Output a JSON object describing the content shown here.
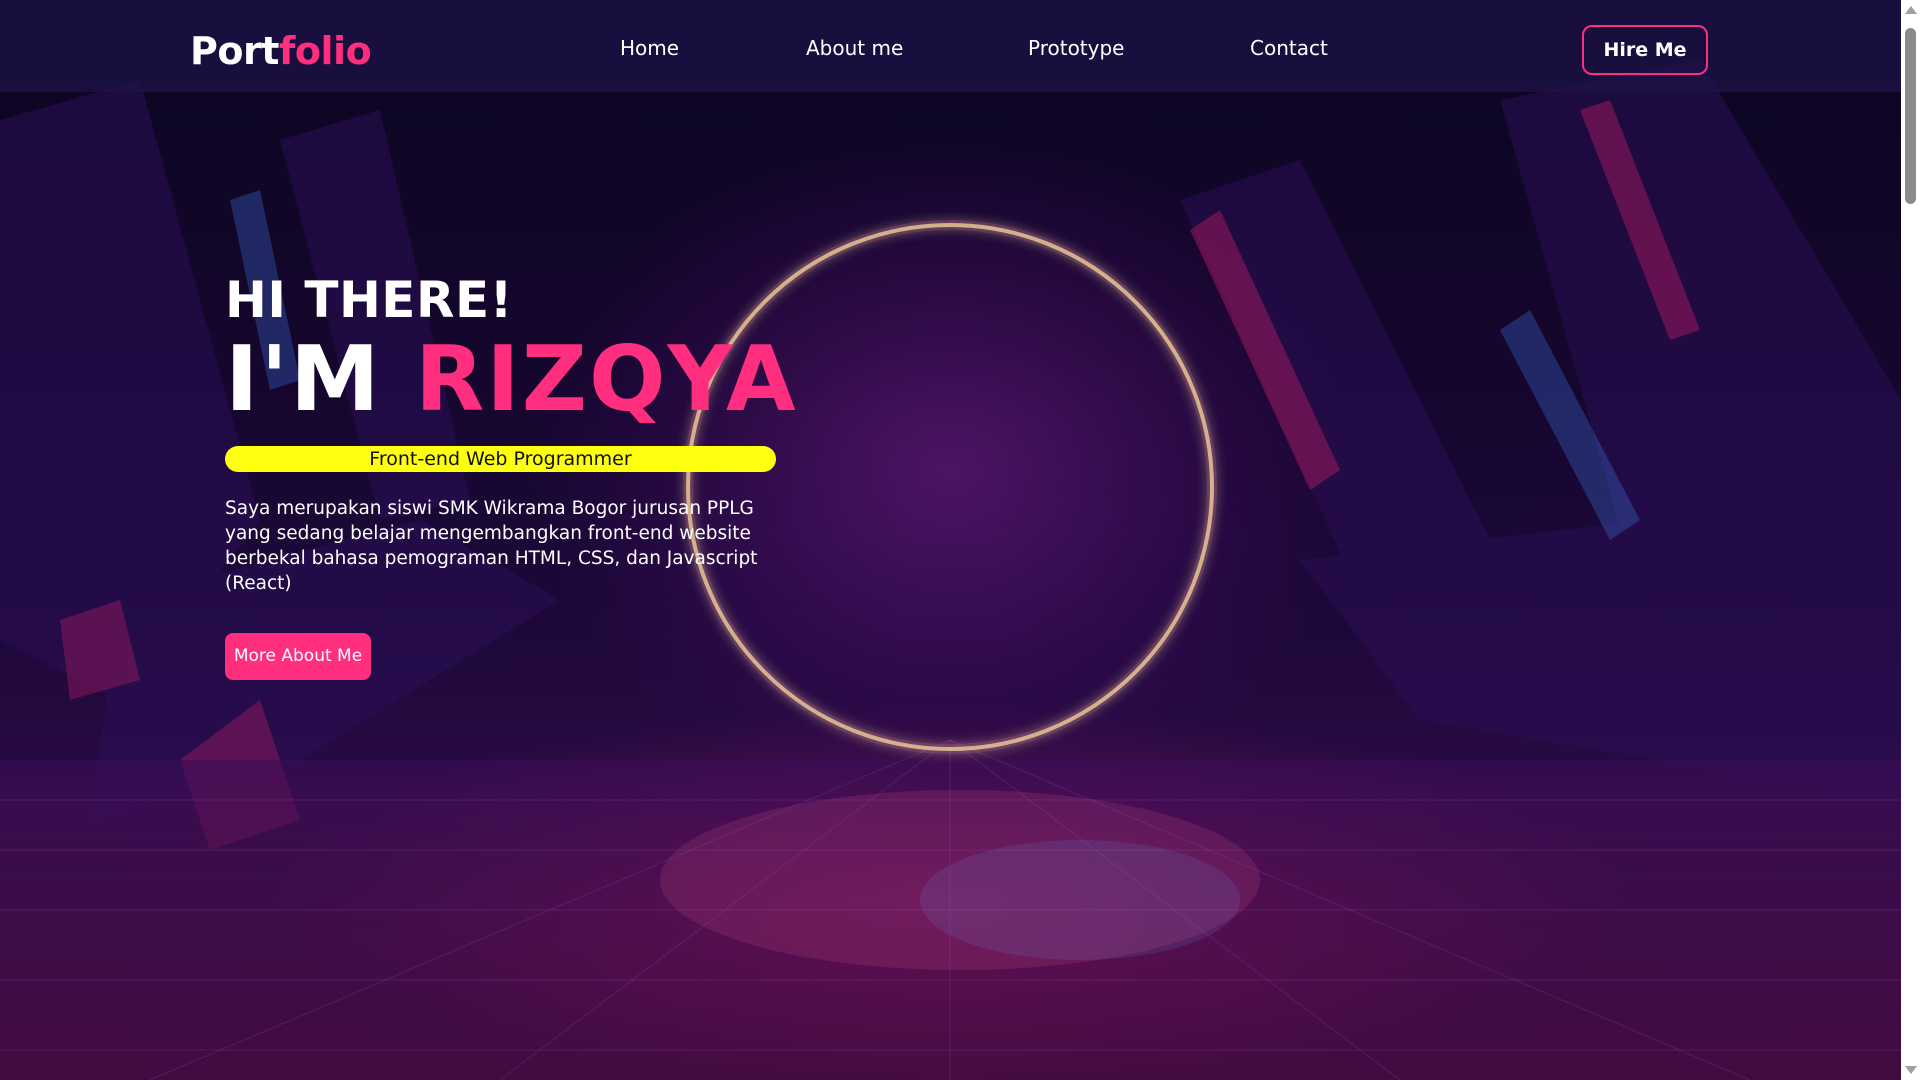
{
  "navbar": {
    "logo_part1": "Port",
    "logo_part2": "folio",
    "links": [
      {
        "label": "Home"
      },
      {
        "label": "About me"
      },
      {
        "label": "Prototype"
      },
      {
        "label": "Contact"
      }
    ],
    "hire_label": "Hire Me"
  },
  "hero": {
    "greeting": "HI THERE!",
    "name_prefix": "I'M ",
    "name_highlight": "RIZQYA",
    "role": "Front-end Web Programmer",
    "description": "Saya merupakan siswi SMK Wikrama Bogor jurusan PPLG yang sedang belajar mengembangkan front-end website berbekal bahasa pemograman HTML, CSS, dan Javascript (React)",
    "cta_label": "More About Me"
  },
  "colors": {
    "accent": "#ff2e7e",
    "role_highlight": "#ffff10",
    "navbar_bg": "#1e1246"
  }
}
